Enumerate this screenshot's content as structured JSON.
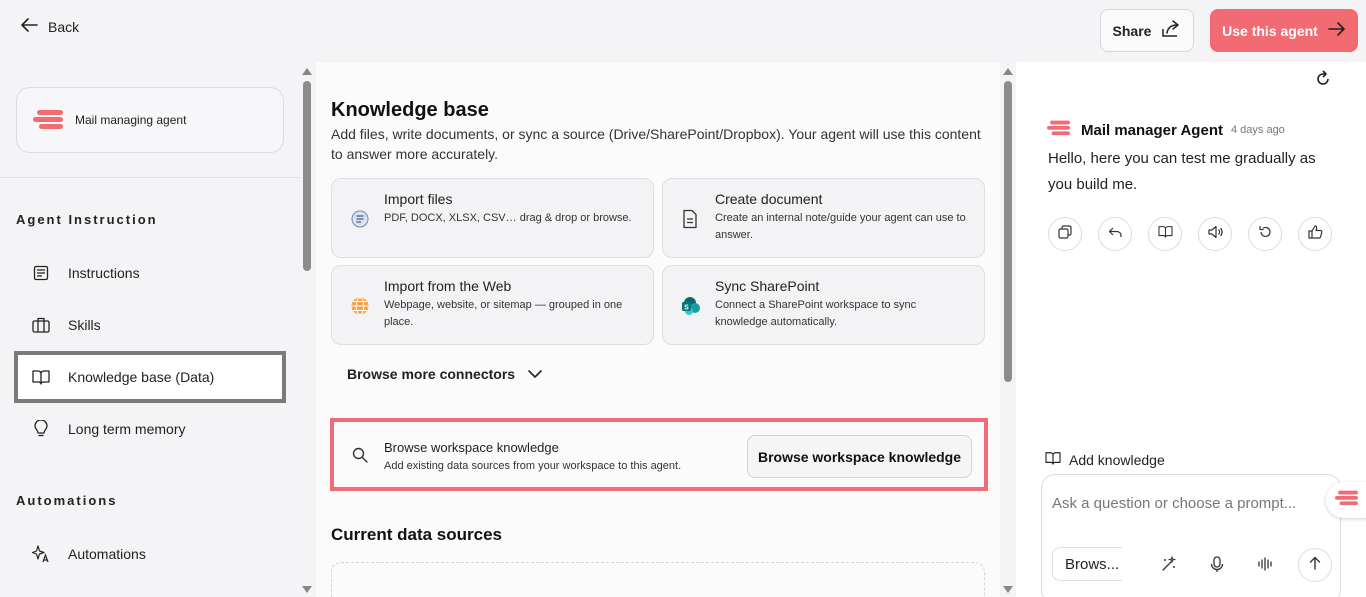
{
  "header": {
    "back_label": "Back",
    "share_label": "Share",
    "use_agent_label": "Use this agent"
  },
  "sidebar": {
    "agent_name": "Mail managing agent",
    "section_instruction": "Agent Instruction",
    "items": [
      {
        "label": "Instructions",
        "icon": "document-icon"
      },
      {
        "label": "Skills",
        "icon": "briefcase-icon"
      },
      {
        "label": "Knowledge base (Data)",
        "icon": "book-icon",
        "active": true
      },
      {
        "label": "Long term memory",
        "icon": "lightbulb-icon"
      }
    ],
    "section_automations": "Automations",
    "automation_item": {
      "label": "Automations",
      "icon": "sparkle-icon"
    }
  },
  "knowledge": {
    "title": "Knowledge base",
    "description": "Add files, write documents, or sync a source (Drive/SharePoint/Dropbox). Your agent will use this content to answer more accurately.",
    "options": [
      {
        "title": "Import files",
        "desc": "PDF, DOCX, XLSX, CSV… drag & drop or browse.",
        "icon": "file-import-icon"
      },
      {
        "title": "Create document",
        "desc": "Create an internal note/guide your agent can use to answer.",
        "icon": "create-document-icon"
      },
      {
        "title": "Import from the Web",
        "desc": "Webpage, website, or sitemap — grouped in one place.",
        "icon": "globe-icon"
      },
      {
        "title": "Sync SharePoint",
        "desc": "Connect a SharePoint workspace to sync knowledge automatically.",
        "icon": "sharepoint-icon"
      }
    ],
    "more_connectors": "Browse more connectors",
    "workspace": {
      "title": "Browse workspace knowledge",
      "desc": "Add existing data sources from your workspace to this agent.",
      "button": "Browse workspace knowledge"
    },
    "current_sources_title": "Current data sources"
  },
  "chat": {
    "agent_name": "Mail manager Agent",
    "time": "4 days ago",
    "message": "Hello, here you can test me gradually as you build me.",
    "add_knowledge": "Add knowledge",
    "input_placeholder": "Ask a question or choose a prompt...",
    "browse_chip": "Brows..."
  },
  "colors": {
    "accent": "#f26b73",
    "highlight_border": "#ee6d78",
    "active_nav_border": "#7a7a7a"
  }
}
